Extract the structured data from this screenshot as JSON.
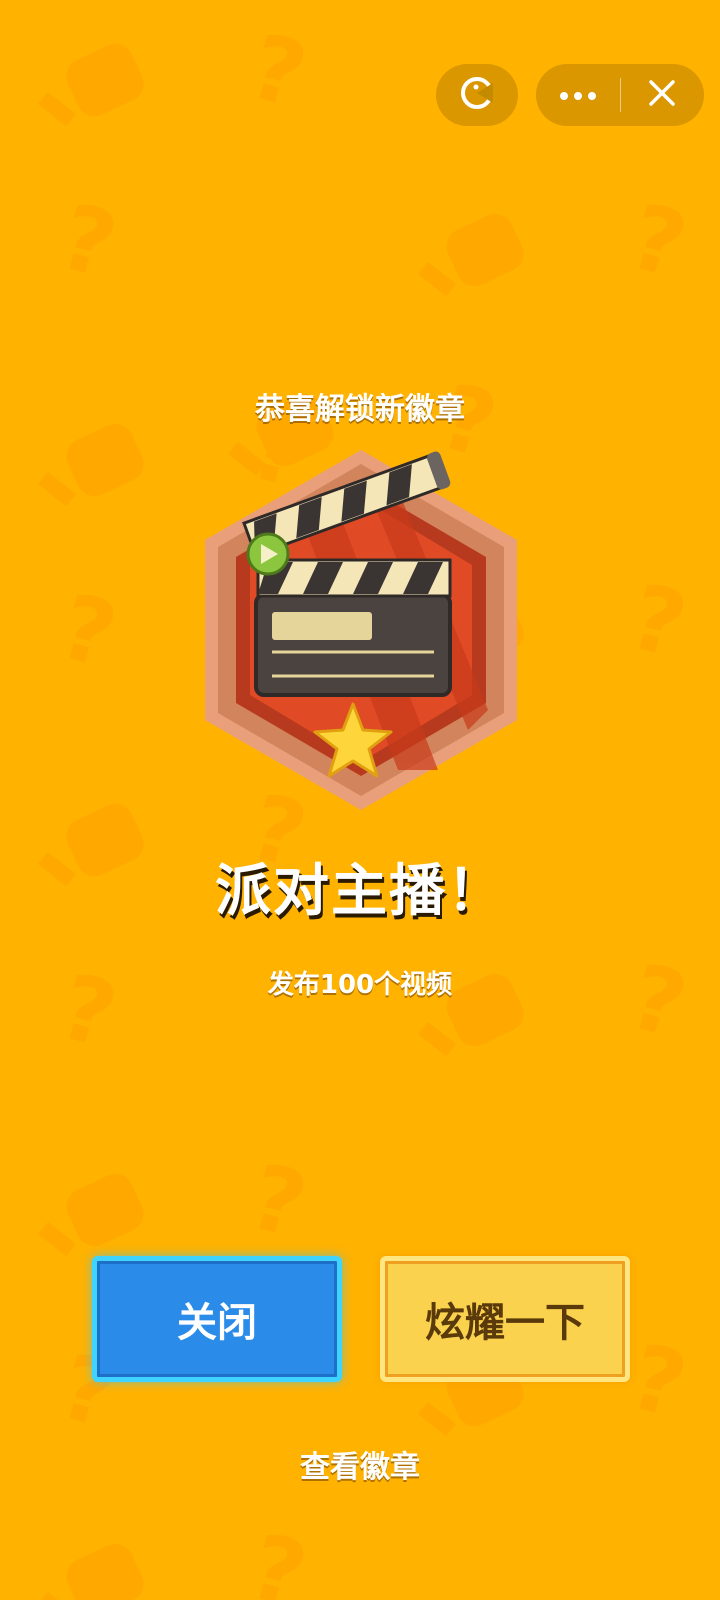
{
  "topbar": {
    "left_icon": "mini-program-icon",
    "more_icon": "more-dots-icon",
    "close_icon": "close-icon"
  },
  "unlock": {
    "subtitle": "恭喜解锁新徽章",
    "badge_name": "派对主播！",
    "badge_description": "发布100个视频"
  },
  "actions": {
    "close_label": "关闭",
    "share_label": "炫耀一下",
    "view_badges_label": "查看徽章"
  },
  "colors": {
    "background": "#FFB200",
    "close_button": "#2A8BE8",
    "share_button": "#FBD24E"
  }
}
